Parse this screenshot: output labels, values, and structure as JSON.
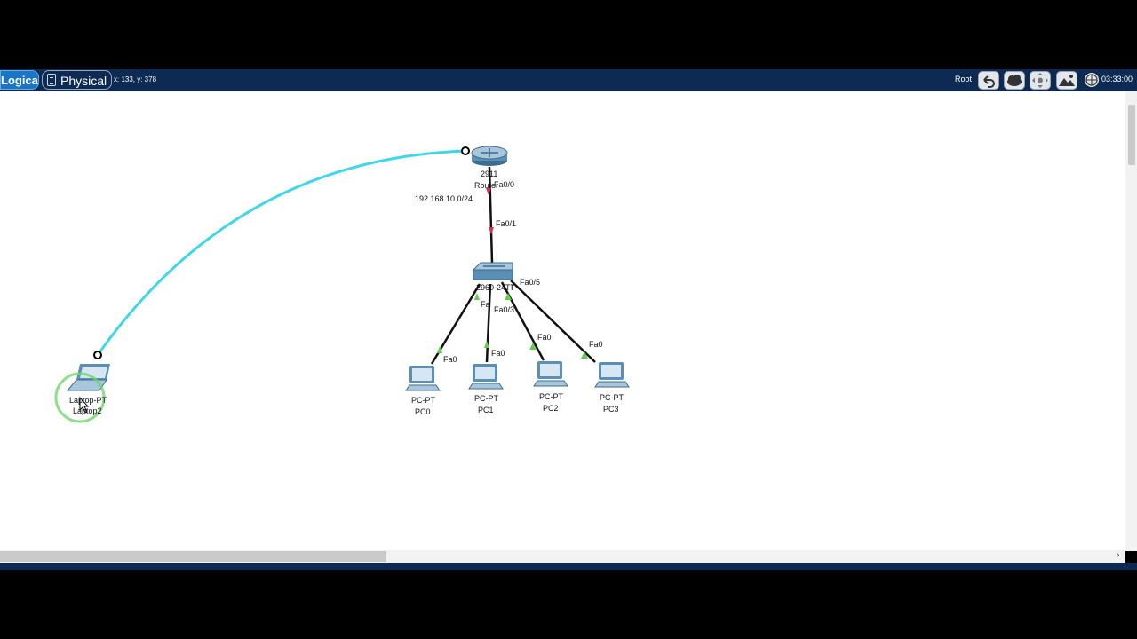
{
  "toolbar": {
    "logical_tab": "Logical",
    "physical_tab": "Physical",
    "coordinates": "x: 133, y: 378",
    "root_label": "Root",
    "clock": "03:33:00"
  },
  "icons": [
    "back-arrow-icon",
    "cloud-icon",
    "move-icon",
    "mountain-icon",
    "globe-clock-icon",
    "physical-view-icon"
  ],
  "colors": {
    "toolbar_bg": "#0d2b52",
    "logical_tab": "#1a76c4",
    "serial_cable": "#3fd7e8",
    "link_up": "#5fcf4a",
    "link_down": "#d2334a"
  },
  "devices": {
    "router": {
      "model": "2911",
      "name": "Router"
    },
    "switch": {
      "model": "2960-24TT",
      "name": "Switch"
    },
    "laptop": {
      "model": "Laptop-PT",
      "name": "Laptop2"
    },
    "pcs": [
      {
        "model": "PC-PT",
        "name": "PC0"
      },
      {
        "model": "PC-PT",
        "name": "PC1"
      },
      {
        "model": "PC-PT",
        "name": "PC2"
      },
      {
        "model": "PC-PT",
        "name": "PC3"
      }
    ]
  },
  "network_label": "192.168.10.0/24",
  "ports": {
    "router_fa00": "Fa0/0",
    "switch_fa01": "Fa0/1",
    "switch_fa05": "Fa0/5",
    "switch_fa03": "Fa0/3",
    "switch_fa": "Fa",
    "switch_f": "F",
    "pc0_fa0": "Fa0",
    "pc1_fa0": "Fa0",
    "pc2_fa0": "Fa0",
    "pc3_fa0": "Fa0"
  }
}
